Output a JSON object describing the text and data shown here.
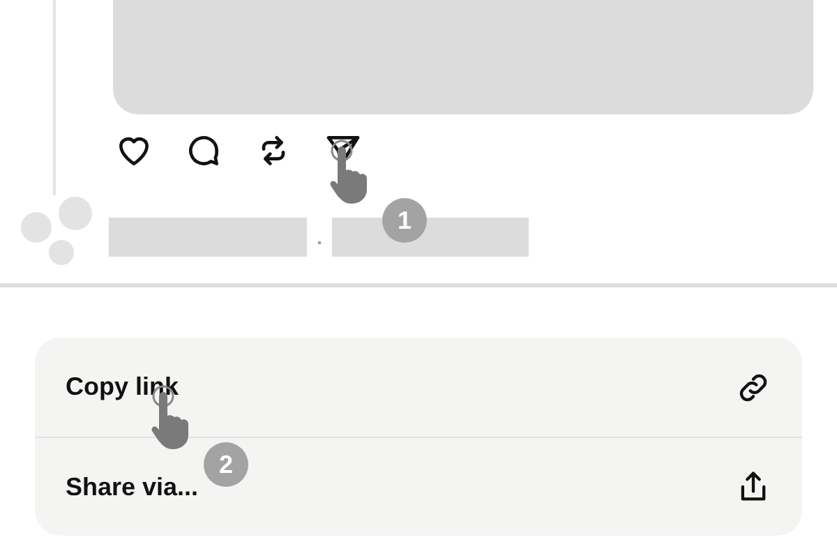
{
  "post": {
    "actions": [
      {
        "kind": "like"
      },
      {
        "kind": "reply"
      },
      {
        "kind": "repost"
      },
      {
        "kind": "share"
      }
    ]
  },
  "steps": [
    {
      "number": "1"
    },
    {
      "number": "2"
    }
  ],
  "share_menu": {
    "items": [
      {
        "label": "Copy link",
        "kind": "link"
      },
      {
        "label": "Share via...",
        "kind": "share"
      }
    ]
  }
}
